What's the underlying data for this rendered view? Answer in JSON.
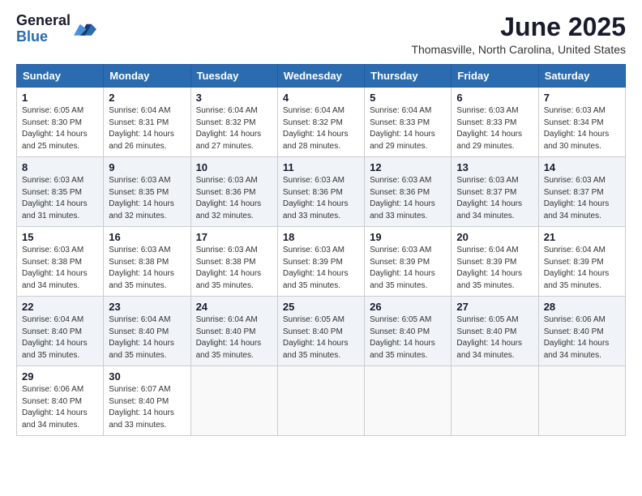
{
  "header": {
    "logo_general": "General",
    "logo_blue": "Blue",
    "main_title": "June 2025",
    "sub_title": "Thomasville, North Carolina, United States"
  },
  "days_of_week": [
    "Sunday",
    "Monday",
    "Tuesday",
    "Wednesday",
    "Thursday",
    "Friday",
    "Saturday"
  ],
  "weeks": [
    [
      {
        "day": "1",
        "sunrise": "6:05 AM",
        "sunset": "8:30 PM",
        "daylight": "14 hours and 25 minutes."
      },
      {
        "day": "2",
        "sunrise": "6:04 AM",
        "sunset": "8:31 PM",
        "daylight": "14 hours and 26 minutes."
      },
      {
        "day": "3",
        "sunrise": "6:04 AM",
        "sunset": "8:32 PM",
        "daylight": "14 hours and 27 minutes."
      },
      {
        "day": "4",
        "sunrise": "6:04 AM",
        "sunset": "8:32 PM",
        "daylight": "14 hours and 28 minutes."
      },
      {
        "day": "5",
        "sunrise": "6:04 AM",
        "sunset": "8:33 PM",
        "daylight": "14 hours and 29 minutes."
      },
      {
        "day": "6",
        "sunrise": "6:03 AM",
        "sunset": "8:33 PM",
        "daylight": "14 hours and 29 minutes."
      },
      {
        "day": "7",
        "sunrise": "6:03 AM",
        "sunset": "8:34 PM",
        "daylight": "14 hours and 30 minutes."
      }
    ],
    [
      {
        "day": "8",
        "sunrise": "6:03 AM",
        "sunset": "8:35 PM",
        "daylight": "14 hours and 31 minutes."
      },
      {
        "day": "9",
        "sunrise": "6:03 AM",
        "sunset": "8:35 PM",
        "daylight": "14 hours and 32 minutes."
      },
      {
        "day": "10",
        "sunrise": "6:03 AM",
        "sunset": "8:36 PM",
        "daylight": "14 hours and 32 minutes."
      },
      {
        "day": "11",
        "sunrise": "6:03 AM",
        "sunset": "8:36 PM",
        "daylight": "14 hours and 33 minutes."
      },
      {
        "day": "12",
        "sunrise": "6:03 AM",
        "sunset": "8:36 PM",
        "daylight": "14 hours and 33 minutes."
      },
      {
        "day": "13",
        "sunrise": "6:03 AM",
        "sunset": "8:37 PM",
        "daylight": "14 hours and 34 minutes."
      },
      {
        "day": "14",
        "sunrise": "6:03 AM",
        "sunset": "8:37 PM",
        "daylight": "14 hours and 34 minutes."
      }
    ],
    [
      {
        "day": "15",
        "sunrise": "6:03 AM",
        "sunset": "8:38 PM",
        "daylight": "14 hours and 34 minutes."
      },
      {
        "day": "16",
        "sunrise": "6:03 AM",
        "sunset": "8:38 PM",
        "daylight": "14 hours and 35 minutes."
      },
      {
        "day": "17",
        "sunrise": "6:03 AM",
        "sunset": "8:38 PM",
        "daylight": "14 hours and 35 minutes."
      },
      {
        "day": "18",
        "sunrise": "6:03 AM",
        "sunset": "8:39 PM",
        "daylight": "14 hours and 35 minutes."
      },
      {
        "day": "19",
        "sunrise": "6:03 AM",
        "sunset": "8:39 PM",
        "daylight": "14 hours and 35 minutes."
      },
      {
        "day": "20",
        "sunrise": "6:04 AM",
        "sunset": "8:39 PM",
        "daylight": "14 hours and 35 minutes."
      },
      {
        "day": "21",
        "sunrise": "6:04 AM",
        "sunset": "8:39 PM",
        "daylight": "14 hours and 35 minutes."
      }
    ],
    [
      {
        "day": "22",
        "sunrise": "6:04 AM",
        "sunset": "8:40 PM",
        "daylight": "14 hours and 35 minutes."
      },
      {
        "day": "23",
        "sunrise": "6:04 AM",
        "sunset": "8:40 PM",
        "daylight": "14 hours and 35 minutes."
      },
      {
        "day": "24",
        "sunrise": "6:04 AM",
        "sunset": "8:40 PM",
        "daylight": "14 hours and 35 minutes."
      },
      {
        "day": "25",
        "sunrise": "6:05 AM",
        "sunset": "8:40 PM",
        "daylight": "14 hours and 35 minutes."
      },
      {
        "day": "26",
        "sunrise": "6:05 AM",
        "sunset": "8:40 PM",
        "daylight": "14 hours and 35 minutes."
      },
      {
        "day": "27",
        "sunrise": "6:05 AM",
        "sunset": "8:40 PM",
        "daylight": "14 hours and 34 minutes."
      },
      {
        "day": "28",
        "sunrise": "6:06 AM",
        "sunset": "8:40 PM",
        "daylight": "14 hours and 34 minutes."
      }
    ],
    [
      {
        "day": "29",
        "sunrise": "6:06 AM",
        "sunset": "8:40 PM",
        "daylight": "14 hours and 34 minutes."
      },
      {
        "day": "30",
        "sunrise": "6:07 AM",
        "sunset": "8:40 PM",
        "daylight": "14 hours and 33 minutes."
      },
      null,
      null,
      null,
      null,
      null
    ]
  ],
  "labels": {
    "sunrise": "Sunrise: ",
    "sunset": "Sunset: ",
    "daylight": "Daylight: "
  }
}
